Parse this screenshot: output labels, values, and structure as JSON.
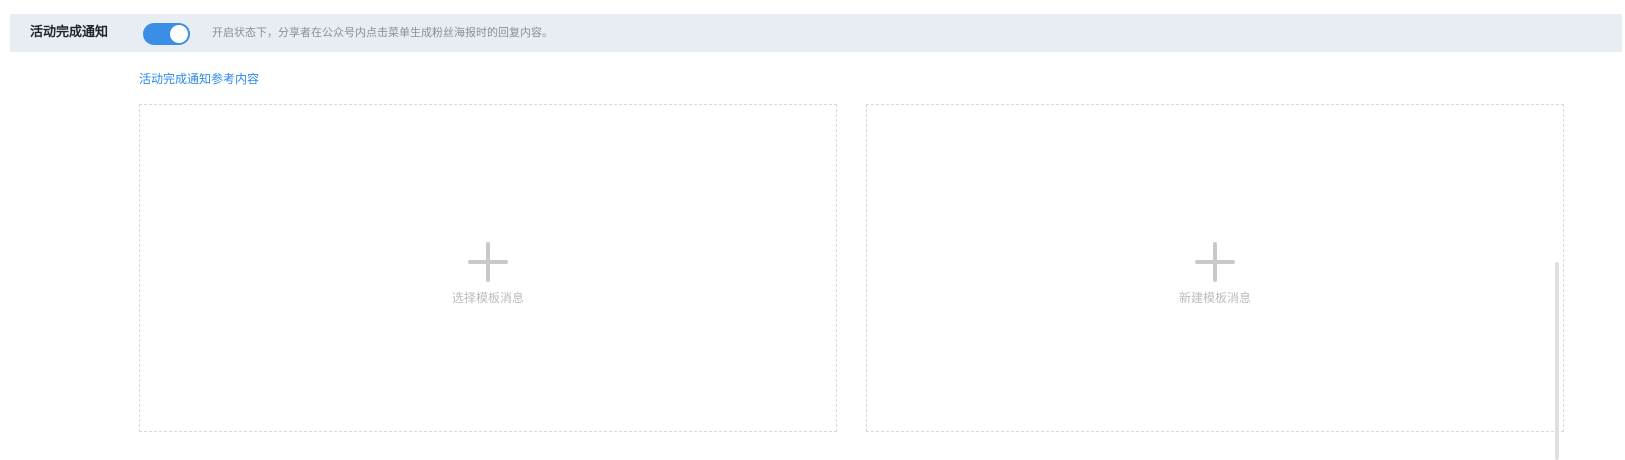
{
  "setting": {
    "label": "活动完成通知",
    "toggle_on": true,
    "description": "开启状态下，分享者在公众号内点击菜单生成粉丝海报时的回复内容。",
    "toggle_color": "#3a8ee6"
  },
  "reference_link": "活动完成通知参考内容",
  "cards": {
    "select_template": {
      "label": "选择模板消息",
      "icon": "plus-icon"
    },
    "new_template": {
      "label": "新建模板消息",
      "icon": "plus-icon"
    }
  },
  "colors": {
    "bar_background": "#e8edf4",
    "link": "#2f8ae6",
    "placeholder": "#bdbdbd"
  }
}
